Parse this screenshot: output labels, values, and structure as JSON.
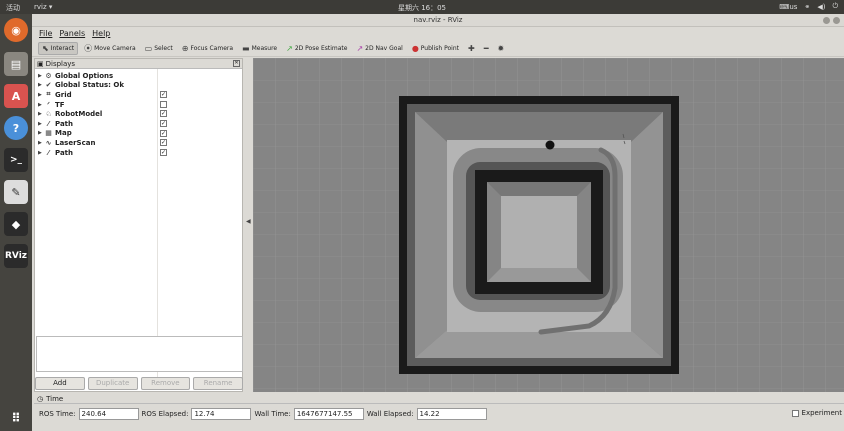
{
  "topbar": {
    "activities": "活动",
    "app_menu": "rviz ▾",
    "clock": "星期六 16：05",
    "keyboard": "us",
    "tray_icons": [
      "keyboard-icon",
      "network-icon",
      "volume-icon",
      "power-icon"
    ]
  },
  "window": {
    "title": "nav.rviz - RViz"
  },
  "launcher": {
    "icons": [
      "ubuntu-logo-icon",
      "files-icon",
      "software-center-icon",
      "help-icon",
      "terminal-icon",
      "text-editor-icon",
      "layers-icon",
      "rviz-icon",
      "apps-grid-icon"
    ],
    "rviz_label": "RViz"
  },
  "menu": {
    "file": "File",
    "panels": "Panels",
    "help": "Help"
  },
  "toolbar": {
    "tools": [
      {
        "label": "Interact",
        "icon": "cursor-icon"
      },
      {
        "label": "Move Camera",
        "icon": "camera-icon"
      },
      {
        "label": "Select",
        "icon": "select-box-icon"
      },
      {
        "label": "Focus Camera",
        "icon": "focus-icon"
      },
      {
        "label": "Measure",
        "icon": "ruler-icon"
      },
      {
        "label": "2D Pose Estimate",
        "icon": "pose-arrow-icon"
      },
      {
        "label": "2D Nav Goal",
        "icon": "nav-goal-arrow-icon"
      },
      {
        "label": "Publish Point",
        "icon": "point-pin-icon"
      }
    ],
    "active_tool": "Interact"
  },
  "displays": {
    "title": "Displays",
    "items": [
      {
        "label": "Global Options",
        "icon": "gear-icon",
        "checkbox": null
      },
      {
        "label": "Global Status: Ok",
        "icon": "check-icon",
        "checkbox": null
      },
      {
        "label": "Grid",
        "icon": "grid-icon",
        "checkbox": true
      },
      {
        "label": "TF",
        "icon": "tf-icon",
        "checkbox": false
      },
      {
        "label": "RobotModel",
        "icon": "robot-icon",
        "checkbox": true
      },
      {
        "label": "Path",
        "icon": "path-icon",
        "checkbox": true
      },
      {
        "label": "Map",
        "icon": "map-icon",
        "checkbox": true
      },
      {
        "label": "LaserScan",
        "icon": "laser-icon",
        "checkbox": true
      },
      {
        "label": "Path",
        "icon": "path-icon",
        "checkbox": true
      }
    ],
    "buttons": {
      "add": "Add",
      "duplicate": "Duplicate",
      "remove": "Remove",
      "rename": "Rename"
    }
  },
  "time": {
    "title": "Time",
    "ros_time_label": "ROS Time:",
    "ros_time": "240.64",
    "ros_elapsed_label": "ROS Elapsed:",
    "ros_elapsed": "12.74",
    "wall_time_label": "Wall Time:",
    "wall_time": "1647677147.55",
    "wall_elapsed_label": "Wall Elapsed:",
    "wall_elapsed": "14.22",
    "experimental_label": "Experiment"
  },
  "colors": {
    "grid_bg": "#858585",
    "obstacle": "#1a1a1a",
    "free": "#b4b4b4",
    "path": "#777777",
    "launcher_bg": "#45443f",
    "topbar_bg": "#3c3b37"
  }
}
